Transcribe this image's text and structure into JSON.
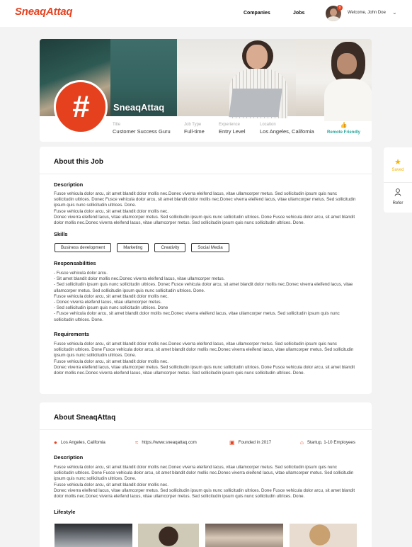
{
  "nav": {
    "logo": "SneaqAttaq",
    "links": [
      "Companies",
      "Jobs"
    ],
    "notification_count": "0",
    "welcome": "Welcome, John Doe"
  },
  "hero": {
    "logo_glyph": "#",
    "company_name": "SneaqAttaq",
    "meta": [
      {
        "label": "Title",
        "value": "Customer Success Guru"
      },
      {
        "label": "Job Type",
        "value": "Full-time"
      },
      {
        "label": "Experience",
        "value": "Entry Level"
      },
      {
        "label": "Location",
        "value": "Los Angeles, California"
      }
    ],
    "remote_label": "Remote Friendly"
  },
  "side": {
    "saved_label": "Saved",
    "refer_label": "Refer"
  },
  "job": {
    "title": "About this Job",
    "description_heading": "Description",
    "description": "Fusce vehicula dolor arcu, sit amet blandit dolor mollis nec.Donec viverra eleifend lacus, vitae ullamcorper metus. Sed sollicitudin ipsum quis nunc sollicitudin ultrices. Donec Fusce vehicula dolor arcu, sit amet blandit dolor mollis nec.Donec viverra eleifend lacus, vitae ullamcorper metus. Sed sollicitudin ipsum quis nunc sollicitudin ultrices. Done.\nFusce vehicula dolor arcu, sit amet blandit dolor mollis nec.\nDonec viverra eleifend lacus, vitae ullamcorper metus. Sed sollicitudin ipsum quis nunc sollicitudin ultrices. Done Fusce vehicula dolor arcu, sit amet blandit dolor mollis nec.Donec viverra eleifend lacus, vitae ullamcorper metus. Sed sollicitudin ipsum quis nunc sollicitudin ultrices. Done.",
    "skills_heading": "Skills",
    "skills": [
      "Business development",
      "Marketing",
      "Creativity",
      "Social Media"
    ],
    "responsibilities_heading": "Responsabilities",
    "responsibilities": "- Fusce vehicula dolor arcu.\n- Sit amet blandit dolor mollis nec.Donec viverra eleifend lacus, vitae ullamcorper metus.\n- Sed sollicitudin ipsum quis nunc sollicitudin ultrices. Donec Fusce vehicula dolor arcu, sit amet blandit dolor mollis nec.Donec viverra eleifend lacus, vitae ullamcorper metus. Sed sollicitudin ipsum quis nunc sollicitudin ultrices. Done.\nFusce vehicula dolor arcu, sit amet blandit dolor mollis nec.\n- Donec viverra eleifend lacus, vitae ullamcorper metus.\n- Sed sollicitudin ipsum quis nunc sollicitudin ultrices. Done\n- Fusce vehicula dolor arcu, sit amet blandit dolor mollis nec.Donec viverra eleifend lacus, vitae ullamcorper metus. Sed sollicitudin ipsum quis nunc sollicitudin ultrices. Done.",
    "requirements_heading": "Requirements",
    "requirements": "Fusce vehicula dolor arcu, sit amet blandit dolor mollis nec.Donec viverra eleifend lacus, vitae ullamcorper metus. Sed sollicitudin ipsum quis nunc sollicitudin ultrices. Done Fusce vehicula dolor arcu, sit amet blandit dolor mollis nec.Donec viverra eleifend lacus, vitae ullamcorper metus. Sed sollicitudin ipsum quis nunc sollicitudin ultrices. Done.\nFusce vehicula dolor arcu, sit amet blandit dolor mollis nec.\nDonec viverra eleifend lacus, vitae ullamcorper metus. Sed sollicitudin ipsum quis nunc sollicitudin ultrices. Done Fusce vehicula dolor arcu, sit amet blandit dolor mollis nec.Donec viverra eleifend lacus, vitae ullamcorper metus. Sed sollicitudin ipsum quis nunc sollicitudin ultrices. Done."
  },
  "about": {
    "title": "About SneaqAttaq",
    "facts": [
      {
        "icon": "location-pin-icon",
        "text": "Los Angeles, Califomia"
      },
      {
        "icon": "rss-icon",
        "text": "https://www.sneaqattaq.com"
      },
      {
        "icon": "calendar-icon",
        "text": "Founded in 2017"
      },
      {
        "icon": "building-icon",
        "text": "Startup, 1-10 Employees"
      }
    ],
    "description_heading": "Description",
    "description": "Fusce vehicula dolor arcu, sit amet blandit dolor mollis nec.Donec viverra eleifend lacus, vitae ullamcorper metus. Sed sollicitudin ipsum quis nunc sollicitudin ultrices. Done Fusce vehicula dolor arcu, sit amet blandit dolor mollis nec.Donec viverra eleifend lacus, vitae ullamcorper metus. Sed sollicitudin ipsum quis nunc sollicitudin ultrices. Done.\nFusce vehicula dolor arcu, sit amet blandit dolor mollis nec.\nDonec viverra eleifend lacus, vitae ullamcorper metus. Sed sollicitudin ipsum quis nunc sollicitudin ultrices. Done Fusce vehicula dolor arcu, sit amet blandit dolor mollis nec.Donec viverra eleifend lacus, vitae ullamcorper metus. Sed sollicitudin ipsum quis nunc sollicitudin ultrices. Done.",
    "lifestyle_heading": "Lifestyle"
  },
  "colors": {
    "brand": "#e5411e",
    "remote": "#26a69a",
    "saved": "#f5b400"
  }
}
